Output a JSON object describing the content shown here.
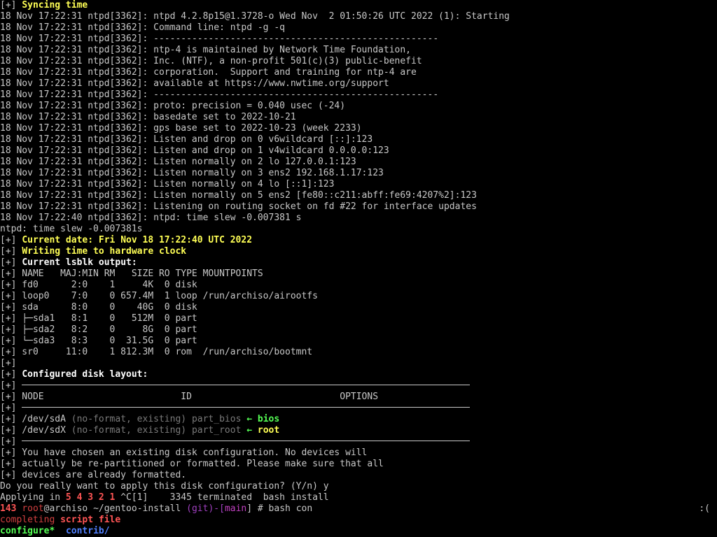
{
  "terminal": {
    "lines": [
      [
        {
          "t": "[+] ",
          "c": "default"
        },
        {
          "t": "Syncing time",
          "c": "yellow"
        }
      ],
      [
        {
          "t": "18 Nov 17:22:31 ntpd[3362]: ntpd 4.2.8p15@1.3728-o Wed Nov  2 01:50:26 UTC 2022 (1): Starting",
          "c": "default"
        }
      ],
      [
        {
          "t": "18 Nov 17:22:31 ntpd[3362]: Command line: ntpd -g -q",
          "c": "default"
        }
      ],
      [
        {
          "t": "18 Nov 17:22:31 ntpd[3362]: ",
          "c": "default"
        },
        {
          "t": "----------------------------------------------------",
          "c": "default"
        }
      ],
      [
        {
          "t": "18 Nov 17:22:31 ntpd[3362]: ntp-4 is maintained by Network Time Foundation,",
          "c": "default"
        }
      ],
      [
        {
          "t": "18 Nov 17:22:31 ntpd[3362]: Inc. (NTF), a non-profit 501(c)(3) public-benefit",
          "c": "default"
        }
      ],
      [
        {
          "t": "18 Nov 17:22:31 ntpd[3362]: corporation.  Support and training for ntp-4 are",
          "c": "default"
        }
      ],
      [
        {
          "t": "18 Nov 17:22:31 ntpd[3362]: available at https://www.nwtime.org/support",
          "c": "default"
        }
      ],
      [
        {
          "t": "18 Nov 17:22:31 ntpd[3362]: ",
          "c": "default"
        },
        {
          "t": "----------------------------------------------------",
          "c": "default"
        }
      ],
      [
        {
          "t": "18 Nov 17:22:31 ntpd[3362]: proto: precision = 0.040 usec (-24)",
          "c": "default"
        }
      ],
      [
        {
          "t": "18 Nov 17:22:31 ntpd[3362]: basedate set to 2022-10-21",
          "c": "default"
        }
      ],
      [
        {
          "t": "18 Nov 17:22:31 ntpd[3362]: gps base set to 2022-10-23 (week 2233)",
          "c": "default"
        }
      ],
      [
        {
          "t": "18 Nov 17:22:31 ntpd[3362]: Listen and drop on 0 v6wildcard [::]:123",
          "c": "default"
        }
      ],
      [
        {
          "t": "18 Nov 17:22:31 ntpd[3362]: Listen and drop on 1 v4wildcard 0.0.0.0:123",
          "c": "default"
        }
      ],
      [
        {
          "t": "18 Nov 17:22:31 ntpd[3362]: Listen normally on 2 lo 127.0.0.1:123",
          "c": "default"
        }
      ],
      [
        {
          "t": "18 Nov 17:22:31 ntpd[3362]: Listen normally on 3 ens2 192.168.1.17:123",
          "c": "default"
        }
      ],
      [
        {
          "t": "18 Nov 17:22:31 ntpd[3362]: Listen normally on 4 lo [::1]:123",
          "c": "default"
        }
      ],
      [
        {
          "t": "18 Nov 17:22:31 ntpd[3362]: Listen normally on 5 ens2 [fe80::c211:abff:fe69:4207%2]:123",
          "c": "default"
        }
      ],
      [
        {
          "t": "18 Nov 17:22:31 ntpd[3362]: Listening on routing socket on fd #22 for interface updates",
          "c": "default"
        }
      ],
      [
        {
          "t": "18 Nov 17:22:40 ntpd[3362]: ntpd: time slew -0.007381 s",
          "c": "default"
        }
      ],
      [
        {
          "t": "ntpd: time slew -0.007381s",
          "c": "default"
        }
      ],
      [
        {
          "t": "[+] ",
          "c": "default"
        },
        {
          "t": "Current date: Fri Nov 18 17:22:40 UTC 2022",
          "c": "yellow"
        }
      ],
      [
        {
          "t": "[+] ",
          "c": "default"
        },
        {
          "t": "Writing time to hardware clock",
          "c": "yellow"
        }
      ],
      [
        {
          "t": "[+] ",
          "c": "default"
        },
        {
          "t": "Current lsblk output:",
          "c": "white"
        }
      ],
      [
        {
          "t": "[+] NAME   MAJ:MIN RM   SIZE RO TYPE MOUNTPOINTS",
          "c": "default"
        }
      ],
      [
        {
          "t": "[+] fd0      2:0    1     4K  0 disk",
          "c": "default"
        }
      ],
      [
        {
          "t": "[+] loop0    7:0    0 657.4M  1 loop /run/archiso/airootfs",
          "c": "default"
        }
      ],
      [
        {
          "t": "[+] sda      8:0    0    40G  0 disk",
          "c": "default"
        }
      ],
      [
        {
          "t": "[+] ├─sda1   8:1    0   512M  0 part",
          "c": "default"
        }
      ],
      [
        {
          "t": "[+] ├─sda2   8:2    0     8G  0 part",
          "c": "default"
        }
      ],
      [
        {
          "t": "[+] └─sda3   8:3    0  31.5G  0 part",
          "c": "default"
        }
      ],
      [
        {
          "t": "[+] sr0     11:0    1 812.3M  0 rom  /run/archiso/bootmnt",
          "c": "default"
        }
      ],
      [
        {
          "t": "[+]",
          "c": "default"
        }
      ],
      [
        {
          "t": "[+] ",
          "c": "default"
        },
        {
          "t": "Configured disk layout:",
          "c": "white"
        }
      ],
      [
        {
          "t": "[+] ",
          "c": "default"
        },
        {
          "rule": true
        }
      ],
      [
        {
          "t": "[+] NODE                         ID                           OPTIONS",
          "c": "default"
        }
      ],
      [
        {
          "t": "[+] ",
          "c": "default"
        },
        {
          "rule": true
        }
      ],
      [
        {
          "t": "[+] /dev/sdA ",
          "c": "default"
        },
        {
          "t": "(no-format, existing)",
          "c": "gray"
        },
        {
          "t": " part_bios ",
          "c": "gray"
        },
        {
          "t": "← ",
          "c": "green"
        },
        {
          "t": "bios",
          "c": "green"
        }
      ],
      [
        {
          "t": "[+] /dev/sdX ",
          "c": "default"
        },
        {
          "t": "(no-format, existing)",
          "c": "gray"
        },
        {
          "t": " part_root ",
          "c": "gray"
        },
        {
          "t": "← ",
          "c": "green"
        },
        {
          "t": "root",
          "c": "yellow"
        }
      ],
      [
        {
          "t": "[+] ",
          "c": "default"
        },
        {
          "rule": true
        }
      ],
      [
        {
          "t": "[+] You have chosen an existing disk configuration. No devices will",
          "c": "default"
        }
      ],
      [
        {
          "t": "[+] actually be re-partitioned or formatted. Please make sure that all",
          "c": "default"
        }
      ],
      [
        {
          "t": "[+] devices are already formatted.",
          "c": "default"
        }
      ],
      [
        {
          "t": "Do you really want to apply this disk configuration? (Y/n) y",
          "c": "default"
        }
      ],
      [
        {
          "t": "Applying in ",
          "c": "default"
        },
        {
          "t": "5 4 3 2 1",
          "c": "redb"
        },
        {
          "t": " ^C[1]    3345 terminated  bash install",
          "c": "default"
        }
      ],
      [
        {
          "t": "143 ",
          "c": "redb"
        },
        {
          "t": "root",
          "c": "red"
        },
        {
          "t": "@archiso ",
          "c": "default"
        },
        {
          "t": "~/gentoo-install ",
          "c": "default"
        },
        {
          "t": "(git)-[",
          "c": "purple"
        },
        {
          "t": "main",
          "c": "magenta"
        },
        {
          "t": "] # bash con",
          "c": "default"
        }
      ],
      [
        {
          "t": "completing ",
          "c": "red"
        },
        {
          "t": "script file",
          "c": "redb"
        }
      ],
      [
        {
          "t": "configure*",
          "c": "green"
        },
        {
          "t": "  ",
          "c": "default"
        },
        {
          "t": "contrib/",
          "c": "blue"
        }
      ]
    ],
    "right_status": ":("
  }
}
